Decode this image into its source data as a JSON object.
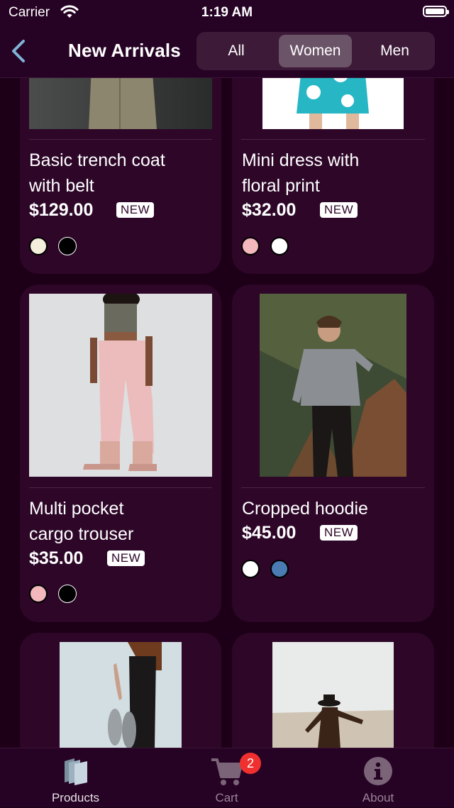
{
  "status_bar": {
    "carrier": "Carrier",
    "time": "1:19 AM"
  },
  "nav": {
    "title": "New Arrivals",
    "segments": [
      "All",
      "Women",
      "Men"
    ],
    "selected_segment": "Women"
  },
  "products": [
    {
      "name": "Basic trench coat\nwith belt",
      "price": "$129.00",
      "badge": "NEW",
      "colors": [
        "#f3efdc",
        "#000000"
      ],
      "photo": "trench-coat-photo"
    },
    {
      "name": "Mini dress with\nfloral print",
      "price": "$32.00",
      "badge": "NEW",
      "colors": [
        "#f2b8bc",
        "#ffffff"
      ],
      "photo": "floral-dress-photo"
    },
    {
      "name": "Multi pocket\ncargo trouser",
      "price": "$35.00",
      "badge": "NEW",
      "colors": [
        "#f2b8bc",
        "#000000"
      ],
      "photo": "cargo-trouser-photo"
    },
    {
      "name": "Cropped hoodie",
      "price": "$45.00",
      "badge": "NEW",
      "colors": [
        "#ffffff",
        "#4a7cb3"
      ],
      "photo": "cropped-hoodie-photo"
    },
    {
      "photo": "shoes-photo"
    },
    {
      "photo": "desert-walk-photo"
    }
  ],
  "tab_bar": {
    "tabs": [
      {
        "label": "Products",
        "icon": "products-icon",
        "active": true
      },
      {
        "label": "Cart",
        "icon": "cart-icon",
        "badge": "2"
      },
      {
        "label": "About",
        "icon": "info-icon"
      }
    ]
  },
  "colors": {
    "background": "#1d0018",
    "card": "#2d0628",
    "bar": "#260324",
    "badge_red": "#f0302f"
  }
}
